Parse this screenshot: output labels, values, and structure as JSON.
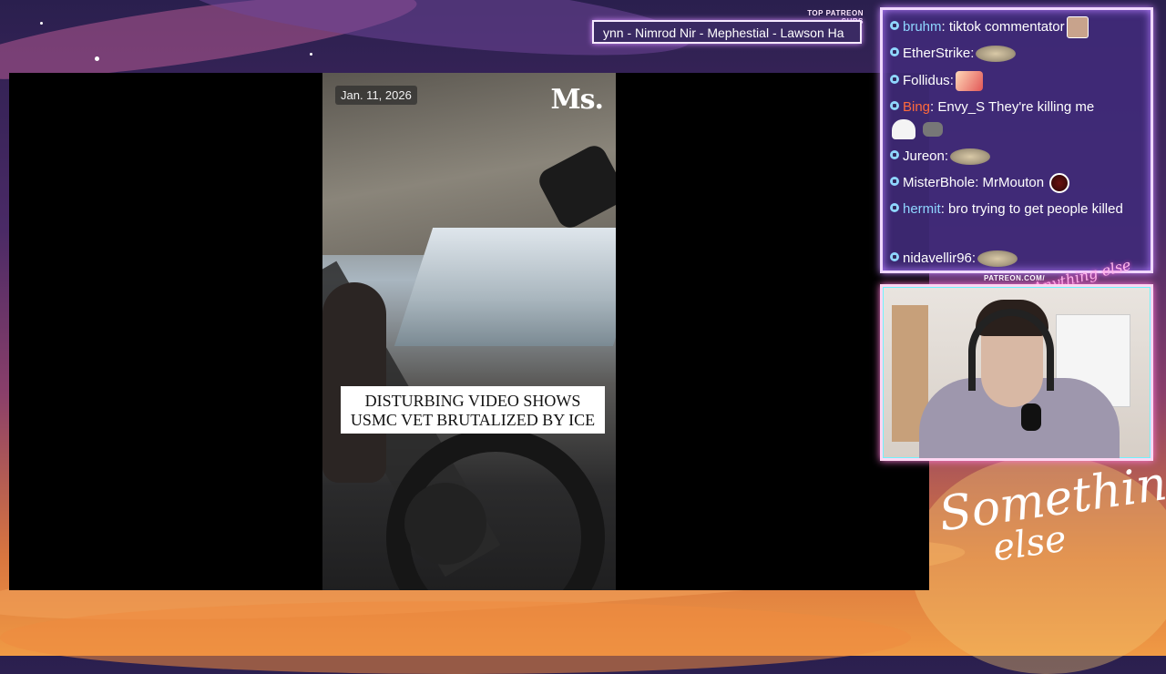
{
  "patreon": {
    "label": "TOP PATREON SUBS",
    "names": "ynn - Nimrod Nir - Mephestial - Lawson Ha",
    "url": "PATREON.COM/",
    "logo_text": "Anything else"
  },
  "video": {
    "date": "Jan. 11, 2026",
    "logo": "Ms.",
    "headline_line1": "DISTURBING VIDEO SHOWS",
    "headline_line2": "USMC VET BRUTALIZED BY ICE"
  },
  "chat": {
    "messages": [
      {
        "user": "bruhm",
        "text": "tiktok commentator",
        "user_color": "#8fd6ff",
        "emote": "face-emote"
      },
      {
        "user": "EtherStrike",
        "text": "",
        "user_color": "#ffffff",
        "emote": "saucer-emote"
      },
      {
        "user": "Follidus",
        "text": "",
        "user_color": "#ffffff",
        "emote": "anime-emote"
      },
      {
        "user": "Bing",
        "text": "Envy_S They're killing me",
        "user_color": "#ff6a3c",
        "emote": "ghost-emote"
      },
      {
        "user": "Jureon",
        "text": "",
        "user_color": "#ffffff",
        "emote": "saucer-emote"
      },
      {
        "user": "MisterBhole",
        "text": "MrMouton",
        "user_color": "#ffffff",
        "emote": "ball-emote"
      },
      {
        "user": "hermit",
        "text": "bro trying to get people killed",
        "user_color": "#8fd6ff",
        "emote": ""
      },
      {
        "user": "nidavellir96",
        "text": "",
        "user_color": "#ffffff",
        "emote": "saucer-emote"
      }
    ]
  },
  "brand": {
    "line1": "Something",
    "line2": "else"
  }
}
